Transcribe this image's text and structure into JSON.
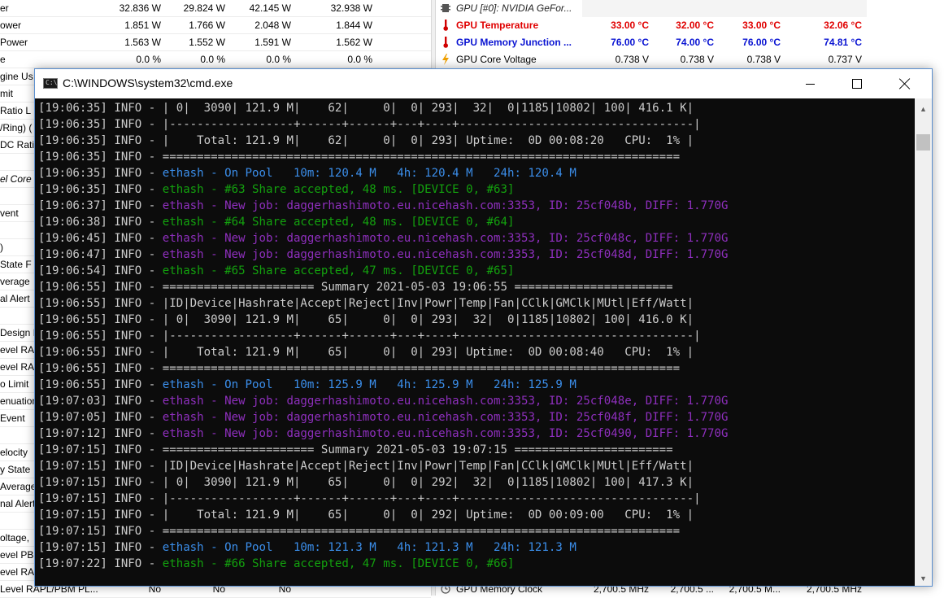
{
  "sensor_left": [
    {
      "label": "er",
      "values": [
        "32.836 W",
        "29.824 W",
        "42.145 W",
        "32.938 W"
      ]
    },
    {
      "label": "ower",
      "values": [
        "1.851 W",
        "1.766 W",
        "2.048 W",
        "1.844 W"
      ]
    },
    {
      "label": "Power",
      "values": [
        "1.563 W",
        "1.552 W",
        "1.591 W",
        "1.562 W"
      ]
    },
    {
      "label": "e",
      "values": [
        "0.0 %",
        "0.0 %",
        "0.0 %",
        "0.0 %"
      ]
    },
    {
      "label": "gine Us",
      "values": [
        "",
        "",
        "",
        ""
      ]
    },
    {
      "label": "mit",
      "values": [
        "",
        "",
        "",
        ""
      ]
    },
    {
      "label": "Ratio L",
      "values": [
        "",
        "",
        "",
        ""
      ]
    },
    {
      "label": "/Ring) (",
      "values": [
        "",
        "",
        "",
        ""
      ]
    },
    {
      "label": "DC Ratio",
      "values": [
        "",
        "",
        "",
        ""
      ]
    },
    {
      "label": "",
      "values": [
        "",
        "",
        "",
        ""
      ]
    },
    {
      "label": "el Core",
      "values": [
        "",
        "",
        "",
        ""
      ]
    },
    {
      "label": "",
      "values": [
        "",
        "",
        "",
        ""
      ]
    },
    {
      "label": "vent",
      "values": [
        "",
        "",
        "",
        ""
      ]
    },
    {
      "label": "",
      "values": [
        "",
        "",
        "",
        ""
      ]
    },
    {
      "label": ")",
      "values": [
        "",
        "",
        "",
        ""
      ]
    },
    {
      "label": " State F",
      "values": [
        "",
        "",
        "",
        ""
      ]
    },
    {
      "label": "verage",
      "values": [
        "",
        "",
        "",
        ""
      ]
    },
    {
      "label": "al Alert",
      "values": [
        "",
        "",
        "",
        ""
      ]
    },
    {
      "label": "",
      "values": [
        "",
        "",
        "",
        ""
      ]
    },
    {
      "label": "Design F",
      "values": [
        "",
        "",
        "",
        ""
      ]
    },
    {
      "label": "evel RA",
      "values": [
        "",
        "",
        "",
        ""
      ]
    },
    {
      "label": "evel RA",
      "values": [
        "",
        "",
        "",
        ""
      ]
    },
    {
      "label": "o Limit",
      "values": [
        "",
        "",
        "",
        ""
      ]
    },
    {
      "label": "enuation",
      "values": [
        "",
        "",
        "",
        ""
      ]
    },
    {
      "label": "Event",
      "values": [
        "",
        "",
        "",
        ""
      ]
    },
    {
      "label": "",
      "values": [
        "",
        "",
        "",
        ""
      ]
    },
    {
      "label": "elocity",
      "values": [
        "",
        "",
        "",
        ""
      ]
    },
    {
      "label": "y State",
      "values": [
        "",
        "",
        "",
        ""
      ]
    },
    {
      "label": "Average",
      "values": [
        "",
        "",
        "",
        ""
      ]
    },
    {
      "label": "nal Alert",
      "values": [
        "",
        "",
        "",
        ""
      ]
    },
    {
      "label": "",
      "values": [
        "",
        "",
        "",
        ""
      ]
    },
    {
      "label": "oltage,",
      "values": [
        "",
        "",
        "",
        ""
      ]
    },
    {
      "label": "evel PB",
      "values": [
        "",
        "",
        "",
        ""
      ]
    },
    {
      "label": "evel RA",
      "values": [
        "",
        "",
        "",
        ""
      ]
    },
    {
      "label": "Level RAPL/PBM PL...",
      "values": [
        "No",
        "No",
        "No",
        ""
      ]
    }
  ],
  "sensor_right": {
    "group_header": "GPU [#0]: NVIDIA GeFor...",
    "rows": [
      {
        "label": "GPU Temperature",
        "values": [
          "33.00 °C",
          "32.00 °C",
          "33.00 °C",
          "32.06 °C"
        ],
        "style": "red"
      },
      {
        "label": "GPU Memory Junction ...",
        "values": [
          "76.00 °C",
          "74.00 °C",
          "76.00 °C",
          "74.81 °C"
        ],
        "style": "blue"
      },
      {
        "label": "GPU Core Voltage",
        "values": [
          "0.738 V",
          "0.738 V",
          "0.738 V",
          "0.737 V"
        ],
        "style": "normal"
      }
    ],
    "bottom_row": {
      "label": "GPU Memory Clock",
      "values": [
        "2,700.5 MHz",
        "2,700.5 ...",
        "2,700.5 M...",
        "2,700.5 MHz"
      ]
    }
  },
  "window": {
    "title": "C:\\WINDOWS\\system32\\cmd.exe",
    "icon_text": "C:\\"
  },
  "console_lines": [
    [
      {
        "t": "[19:06:35] INFO - | 0|  3090| 121.9 M|    62|     0|  0| 293|  32|  0|1185|10802| 100| 416.1 K|",
        "c": "w"
      }
    ],
    [
      {
        "t": "[19:06:35] INFO - |------------------+------+------+---+----+----------------------------------|",
        "c": "w"
      }
    ],
    [
      {
        "t": "[19:06:35] INFO - |    Total: 121.9 M|    62|     0|  0| 293| Uptime:  0D 00:08:20   CPU:  1% |",
        "c": "w"
      }
    ],
    [
      {
        "t": "[19:06:35] INFO - ===========================================================================",
        "c": "w"
      }
    ],
    [
      {
        "t": "[19:06:35] INFO - ",
        "c": "w"
      },
      {
        "t": "ethash - On Pool   10m: 120.4 M   4h: 120.4 M   24h: 120.4 M",
        "c": "b"
      }
    ],
    [
      {
        "t": "[19:06:35] INFO - ",
        "c": "w"
      },
      {
        "t": "ethash - #63 Share accepted, 48 ms. [DEVICE 0, #63]",
        "c": "g"
      }
    ],
    [
      {
        "t": "[19:06:37] INFO - ",
        "c": "w"
      },
      {
        "t": "ethash - New job: daggerhashimoto.eu.nicehash.com:3353, ID: 25cf048b, DIFF: 1.770G",
        "c": "p"
      }
    ],
    [
      {
        "t": "[19:06:38] INFO - ",
        "c": "w"
      },
      {
        "t": "ethash - #64 Share accepted, 48 ms. [DEVICE 0, #64]",
        "c": "g"
      }
    ],
    [
      {
        "t": "[19:06:45] INFO - ",
        "c": "w"
      },
      {
        "t": "ethash - New job: daggerhashimoto.eu.nicehash.com:3353, ID: 25cf048c, DIFF: 1.770G",
        "c": "p"
      }
    ],
    [
      {
        "t": "[19:06:47] INFO - ",
        "c": "w"
      },
      {
        "t": "ethash - New job: daggerhashimoto.eu.nicehash.com:3353, ID: 25cf048d, DIFF: 1.770G",
        "c": "p"
      }
    ],
    [
      {
        "t": "[19:06:54] INFO - ",
        "c": "w"
      },
      {
        "t": "ethash - #65 Share accepted, 47 ms. [DEVICE 0, #65]",
        "c": "g"
      }
    ],
    [
      {
        "t": "[19:06:55] INFO - ====================== Summary 2021-05-03 19:06:55 =======================",
        "c": "w"
      }
    ],
    [
      {
        "t": "[19:06:55] INFO - |ID|Device|Hashrate|Accept|Reject|Inv|Powr|Temp|Fan|CClk|GMClk|MUtl|Eff/Watt|",
        "c": "w"
      }
    ],
    [
      {
        "t": "[19:06:55] INFO - | 0|  3090| 121.9 M|    65|     0|  0| 293|  32|  0|1185|10802| 100| 416.0 K|",
        "c": "w"
      }
    ],
    [
      {
        "t": "[19:06:55] INFO - |------------------+------+------+---+----+----------------------------------|",
        "c": "w"
      }
    ],
    [
      {
        "t": "[19:06:55] INFO - |    Total: 121.9 M|    65|     0|  0| 293| Uptime:  0D 00:08:40   CPU:  1% |",
        "c": "w"
      }
    ],
    [
      {
        "t": "[19:06:55] INFO - ===========================================================================",
        "c": "w"
      }
    ],
    [
      {
        "t": "[19:06:55] INFO - ",
        "c": "w"
      },
      {
        "t": "ethash - On Pool   10m: 125.9 M   4h: 125.9 M   24h: 125.9 M",
        "c": "b"
      }
    ],
    [
      {
        "t": "[19:07:03] INFO - ",
        "c": "w"
      },
      {
        "t": "ethash - New job: daggerhashimoto.eu.nicehash.com:3353, ID: 25cf048e, DIFF: 1.770G",
        "c": "p"
      }
    ],
    [
      {
        "t": "[19:07:05] INFO - ",
        "c": "w"
      },
      {
        "t": "ethash - New job: daggerhashimoto.eu.nicehash.com:3353, ID: 25cf048f, DIFF: 1.770G",
        "c": "p"
      }
    ],
    [
      {
        "t": "[19:07:12] INFO - ",
        "c": "w"
      },
      {
        "t": "ethash - New job: daggerhashimoto.eu.nicehash.com:3353, ID: 25cf0490, DIFF: 1.770G",
        "c": "p"
      }
    ],
    [
      {
        "t": "[19:07:15] INFO - ====================== Summary 2021-05-03 19:07:15 =======================",
        "c": "w"
      }
    ],
    [
      {
        "t": "[19:07:15] INFO - |ID|Device|Hashrate|Accept|Reject|Inv|Powr|Temp|Fan|CClk|GMClk|MUtl|Eff/Watt|",
        "c": "w"
      }
    ],
    [
      {
        "t": "[19:07:15] INFO - | 0|  3090| 121.9 M|    65|     0|  0| 292|  32|  0|1185|10802| 100| 417.3 K|",
        "c": "w"
      }
    ],
    [
      {
        "t": "[19:07:15] INFO - |------------------+------+------+---+----+----------------------------------|",
        "c": "w"
      }
    ],
    [
      {
        "t": "[19:07:15] INFO - |    Total: 121.9 M|    65|     0|  0| 292| Uptime:  0D 00:09:00   CPU:  1% |",
        "c": "w"
      }
    ],
    [
      {
        "t": "[19:07:15] INFO - ===========================================================================",
        "c": "w"
      }
    ],
    [
      {
        "t": "[19:07:15] INFO - ",
        "c": "w"
      },
      {
        "t": "ethash - On Pool   10m: 121.3 M   4h: 121.3 M   24h: 121.3 M",
        "c": "b"
      }
    ],
    [
      {
        "t": "[19:07:22] INFO - ",
        "c": "w"
      },
      {
        "t": "ethash - #66 Share accepted, 47 ms. [DEVICE 0, #66]",
        "c": "g"
      }
    ]
  ],
  "colors": {
    "console_bg": "#0c0c0c",
    "console_text": "#cccccc",
    "blue": "#3b8eea",
    "green": "#13a10e",
    "purple": "#8e2fbd",
    "sensor_red": "#e00000",
    "sensor_blue": "#0a14d2"
  }
}
